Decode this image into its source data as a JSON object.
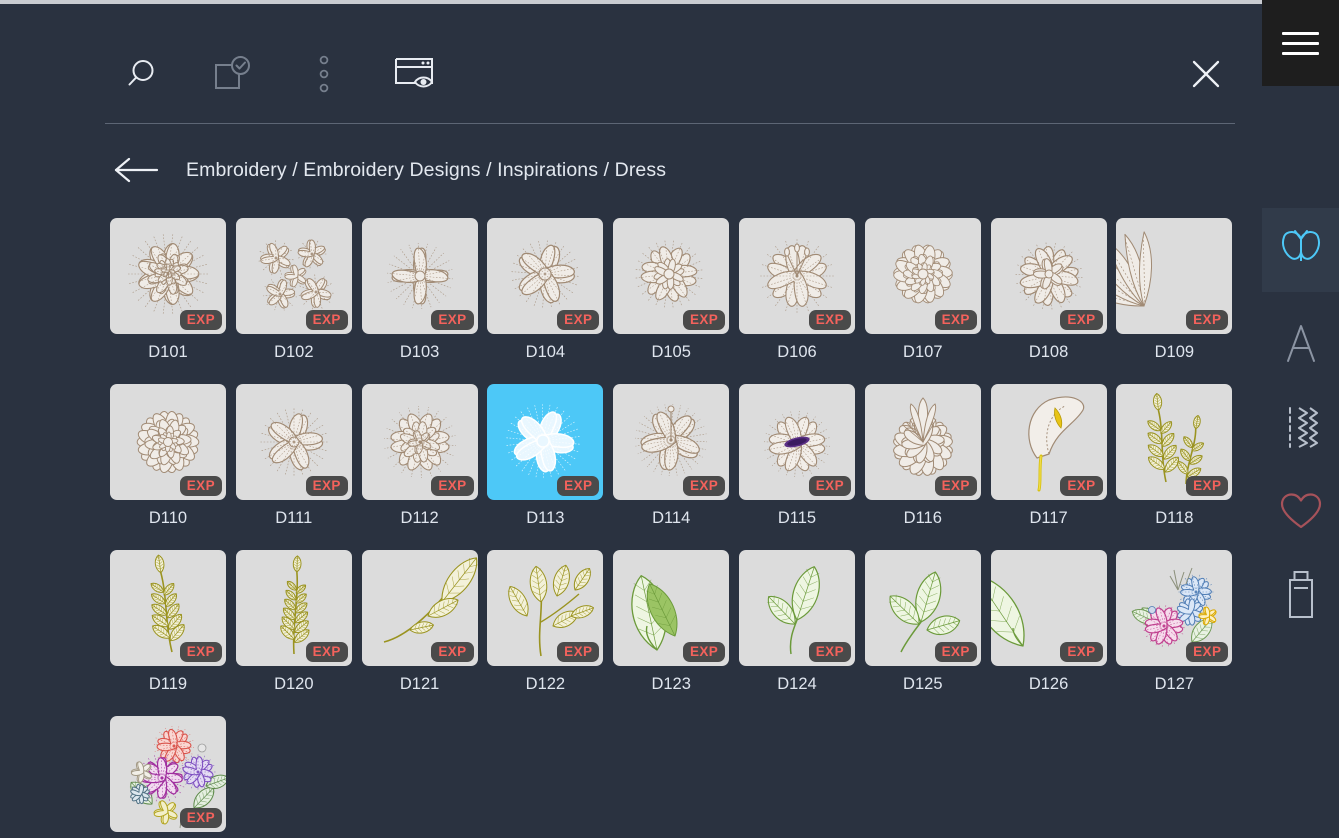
{
  "window": {
    "background_color": "#2a3240",
    "accent_selected_color": "#4dc8f7",
    "badge_text_color": "#f4625c"
  },
  "toolbar": {
    "items": [
      {
        "name": "search-icon",
        "label": "Search"
      },
      {
        "name": "select-all-icon",
        "label": "Select"
      },
      {
        "name": "more-options-icon",
        "label": "More Options"
      },
      {
        "name": "preview-window-icon",
        "label": "Preview"
      }
    ],
    "close_label": "Close"
  },
  "breadcrumb": {
    "back_label": "Back",
    "path": "Embroidery / Embroidery Designs / Inspirations / Dress"
  },
  "grid": {
    "badge_label": "EXP",
    "selected_id": "D113",
    "items": [
      {
        "id": "D101",
        "art": "peony",
        "palette": "beige"
      },
      {
        "id": "D102",
        "art": "blossom-cluster",
        "palette": "beige"
      },
      {
        "id": "D103",
        "art": "four-petal",
        "palette": "beige"
      },
      {
        "id": "D104",
        "art": "dogwood",
        "palette": "beige"
      },
      {
        "id": "D105",
        "art": "wild-rose",
        "palette": "beige"
      },
      {
        "id": "D106",
        "art": "lily",
        "palette": "beige"
      },
      {
        "id": "D107",
        "art": "aster",
        "palette": "beige"
      },
      {
        "id": "D108",
        "art": "magnolia",
        "palette": "beige"
      },
      {
        "id": "D109",
        "art": "feather-bloom",
        "palette": "beige"
      },
      {
        "id": "D110",
        "art": "dahlia",
        "palette": "beige"
      },
      {
        "id": "D111",
        "art": "cherry-blossom",
        "palette": "beige"
      },
      {
        "id": "D112",
        "art": "camellia",
        "palette": "beige"
      },
      {
        "id": "D113",
        "art": "poppy",
        "palette": "white-on-blue"
      },
      {
        "id": "D114",
        "art": "hibiscus",
        "palette": "beige"
      },
      {
        "id": "D115",
        "art": "anemone",
        "palette": "beige-purple"
      },
      {
        "id": "D116",
        "art": "protea",
        "palette": "beige"
      },
      {
        "id": "D117",
        "art": "calla-lily",
        "palette": "beige-yellow"
      },
      {
        "id": "D118",
        "art": "sprig-tall",
        "palette": "olive"
      },
      {
        "id": "D119",
        "art": "sprig-leafy",
        "palette": "olive"
      },
      {
        "id": "D120",
        "art": "sprig-slim",
        "palette": "olive"
      },
      {
        "id": "D121",
        "art": "long-leaf",
        "palette": "olive"
      },
      {
        "id": "D122",
        "art": "bud-branch",
        "palette": "olive"
      },
      {
        "id": "D123",
        "art": "single-leaf",
        "palette": "green"
      },
      {
        "id": "D124",
        "art": "twin-leaf",
        "palette": "green"
      },
      {
        "id": "D125",
        "art": "triple-leaf",
        "palette": "green"
      },
      {
        "id": "D126",
        "art": "broad-leaf",
        "palette": "green"
      },
      {
        "id": "D127",
        "art": "bouquet-pastel",
        "palette": "multicolor"
      },
      {
        "id": "",
        "art": "bouquet-rich",
        "palette": "multicolor"
      }
    ]
  },
  "right_rail": {
    "menu_label": "Menu",
    "items": [
      {
        "name": "butterfly-icon",
        "label": "Embroidery",
        "active": true
      },
      {
        "name": "letter-a-icon",
        "label": "Lettering",
        "active": false
      },
      {
        "name": "stitch-pattern-icon",
        "label": "Stitches",
        "active": false
      },
      {
        "name": "heart-icon",
        "label": "Favorites",
        "active": false
      },
      {
        "name": "usb-stick-icon",
        "label": "USB Device",
        "active": false
      }
    ]
  }
}
